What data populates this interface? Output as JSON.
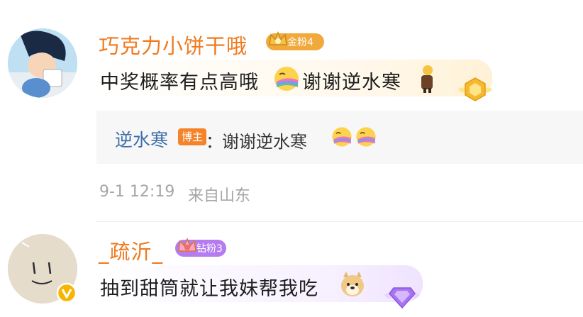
{
  "comments": [
    {
      "username": "巧克力小饼干哦",
      "badge_label": "金粉4",
      "badge_color": "#f0a93a",
      "text": "中奖概率有点高哦",
      "text_tail": "谢谢逆水寒",
      "inline_icons": [
        "rainbow-kiss-emoji-icon",
        "doll-icon"
      ],
      "decoration_icon": "gold-gem-icon",
      "reply": {
        "name": "逆水寒",
        "tag": "博主",
        "separator": "：",
        "text": "谢谢逆水寒",
        "emoji_icons": [
          "rainbow-kiss-emoji-icon",
          "rainbow-kiss-emoji-icon"
        ]
      },
      "timestamp": "9-1 12:19",
      "location": "来自山东"
    },
    {
      "username": "_疏沂_",
      "badge_label": "钻粉3",
      "badge_color": "#b57cf0",
      "text": "抽到甜筒就让我妹帮我吃",
      "inline_icons": [
        "doge-emoji-icon"
      ],
      "decoration_icon": "purple-diamond-icon",
      "verified_icon": "verified-v-icon"
    }
  ],
  "colors": {
    "username": "#f07a1e",
    "reply_name": "#3d6fa8",
    "author_tag": "#f4832a",
    "meta": "#a6a6a6"
  }
}
